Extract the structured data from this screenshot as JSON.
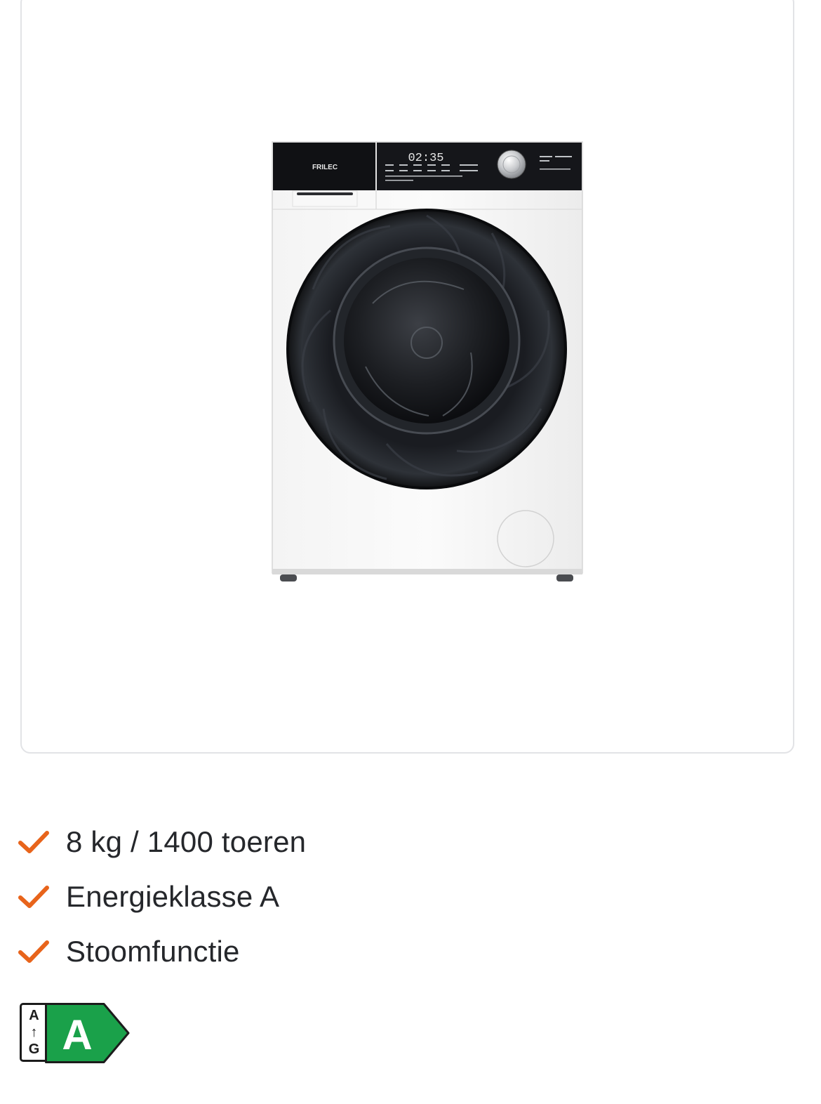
{
  "product": {
    "brand": "FRILEC",
    "display_time": "02:35"
  },
  "usps": [
    {
      "icon": "check-icon",
      "text": "8 kg / 1400 toeren"
    },
    {
      "icon": "check-icon",
      "text": "Energieklasse A"
    },
    {
      "icon": "check-icon",
      "text": "Stoomfunctie"
    }
  ],
  "energy_label": {
    "scale_top": "A",
    "scale_arrow": "↑",
    "scale_bottom": "G",
    "class": "A"
  },
  "colors": {
    "check": "#e8641b",
    "energy_green": "#1aa14a",
    "card_border": "#e2e3e6"
  }
}
